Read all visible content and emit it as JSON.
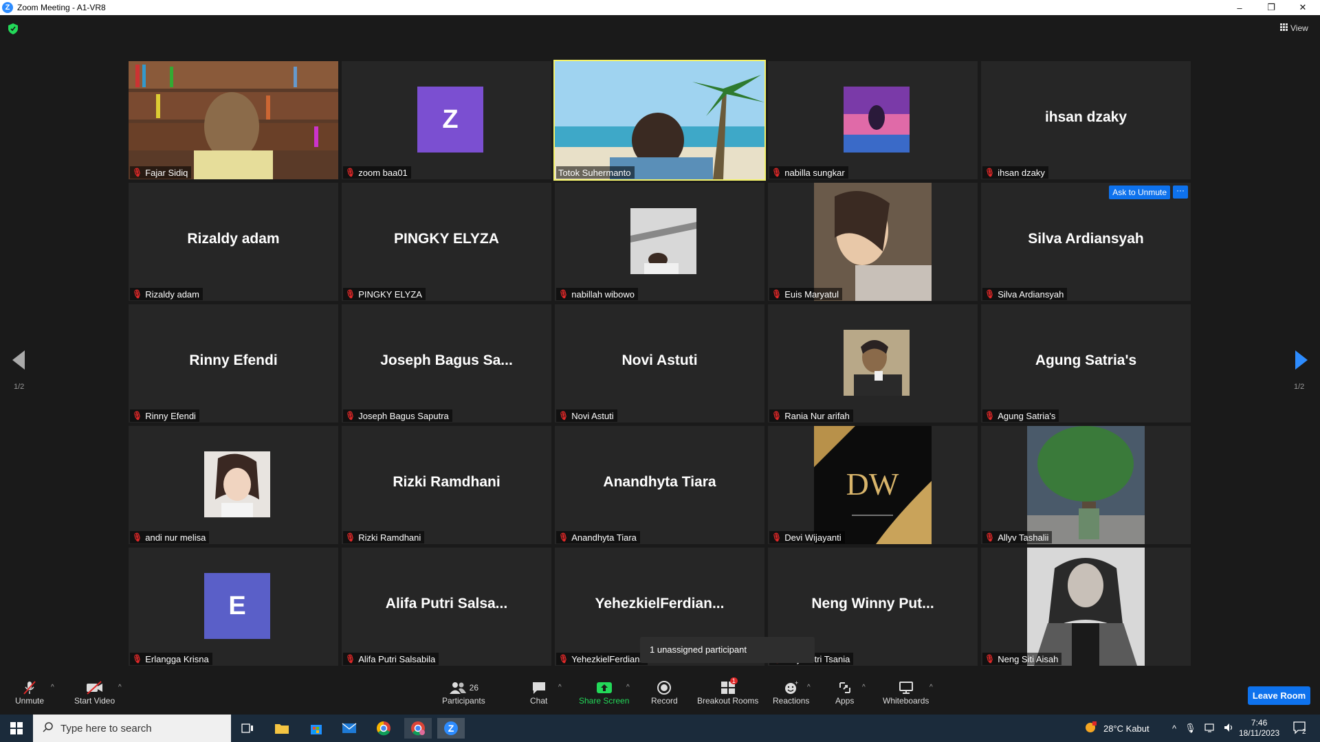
{
  "window": {
    "title": "Zoom Meeting - A1-VR8",
    "app_logo": "Z",
    "controls": [
      "–",
      "❐",
      "✕"
    ]
  },
  "view_button": "View",
  "tiles": [
    {
      "name": "Fajar Sidiq",
      "kind": "video",
      "muted": true
    },
    {
      "name": "zoom baa01",
      "kind": "avatar",
      "initial": "Z",
      "color": "#7b4fd1",
      "muted": true
    },
    {
      "name": "Totok Suhermanto",
      "kind": "video",
      "active": true,
      "muted": false
    },
    {
      "name": "nabilla sungkar",
      "kind": "photo",
      "muted": true
    },
    {
      "name": "ihsan dzaky",
      "kind": "name",
      "big": "ihsan dzaky",
      "muted": true
    },
    {
      "name": "Rizaldy adam",
      "kind": "name",
      "big": "Rizaldy adam",
      "muted": true
    },
    {
      "name": "PINGKY ELYZA",
      "kind": "name",
      "big": "PINGKY ELYZA",
      "muted": true
    },
    {
      "name": "nabillah wibowo",
      "kind": "photo",
      "muted": true
    },
    {
      "name": "Euis Maryatul",
      "kind": "tallphoto",
      "muted": true
    },
    {
      "name": "Silva Ardiansyah",
      "kind": "name",
      "big": "Silva Ardiansyah",
      "muted": true,
      "hover": true
    },
    {
      "name": "Rinny Efendi",
      "kind": "name",
      "big": "Rinny Efendi",
      "muted": true
    },
    {
      "name": "Joseph Bagus Saputra",
      "kind": "name",
      "big": "Joseph Bagus Sa...",
      "muted": true
    },
    {
      "name": "Novi Astuti",
      "kind": "name",
      "big": "Novi Astuti",
      "muted": true
    },
    {
      "name": "Rania Nur arifah",
      "kind": "photo",
      "muted": true
    },
    {
      "name": "Agung Satria's",
      "kind": "name",
      "big": "Agung Satria's",
      "muted": true
    },
    {
      "name": "andi nur melisa",
      "kind": "photo",
      "muted": true
    },
    {
      "name": "Rizki Ramdhani",
      "kind": "name",
      "big": "Rizki Ramdhani",
      "muted": true
    },
    {
      "name": "Anandhyta Tiara",
      "kind": "name",
      "big": "Anandhyta Tiara",
      "muted": true
    },
    {
      "name": "Devi Wijayanti",
      "kind": "logo",
      "logo_text": "DW",
      "muted": true
    },
    {
      "name": "Allyv Tashalii",
      "kind": "tallphoto",
      "muted": true
    },
    {
      "name": "Erlangga Krisna",
      "kind": "avatar",
      "initial": "E",
      "color": "#5a5fc8",
      "muted": true
    },
    {
      "name": "Alifa Putri Salsabila",
      "kind": "name",
      "big": "Alifa Putri Salsa...",
      "muted": true
    },
    {
      "name": "YehezkielFerdiank",
      "kind": "name",
      "big": "YehezkielFerdian...",
      "muted": true
    },
    {
      "name": "inny Putri Tsania",
      "kind": "name",
      "big": "Neng Winny Put...",
      "muted": true
    },
    {
      "name": "Neng Siti Aisah",
      "kind": "tallphoto",
      "muted": true
    }
  ],
  "hover_actions": {
    "ask_to_unmute": "Ask to Unmute",
    "more": "···"
  },
  "pager": {
    "left_label": "1/2",
    "right_label": "1/2"
  },
  "tooltip": "1 unassigned participant",
  "toolbar": {
    "unmute": "Unmute",
    "start_video": "Start Video",
    "participants": "Participants",
    "participants_count": "26",
    "chat": "Chat",
    "share_screen": "Share Screen",
    "record": "Record",
    "breakout_rooms": "Breakout Rooms",
    "breakout_badge": "1",
    "reactions": "Reactions",
    "apps": "Apps",
    "whiteboards": "Whiteboards",
    "leave_room": "Leave Room"
  },
  "taskbar": {
    "search_placeholder": "Type here to search",
    "weather": "28°C  Kabut",
    "time": "7:46",
    "date": "18/11/2023",
    "notif_count": "2"
  },
  "colors": {
    "accent": "#0e72ed",
    "active_border": "#f4f36b",
    "mute_red": "#e02828",
    "share_green": "#23d959"
  }
}
